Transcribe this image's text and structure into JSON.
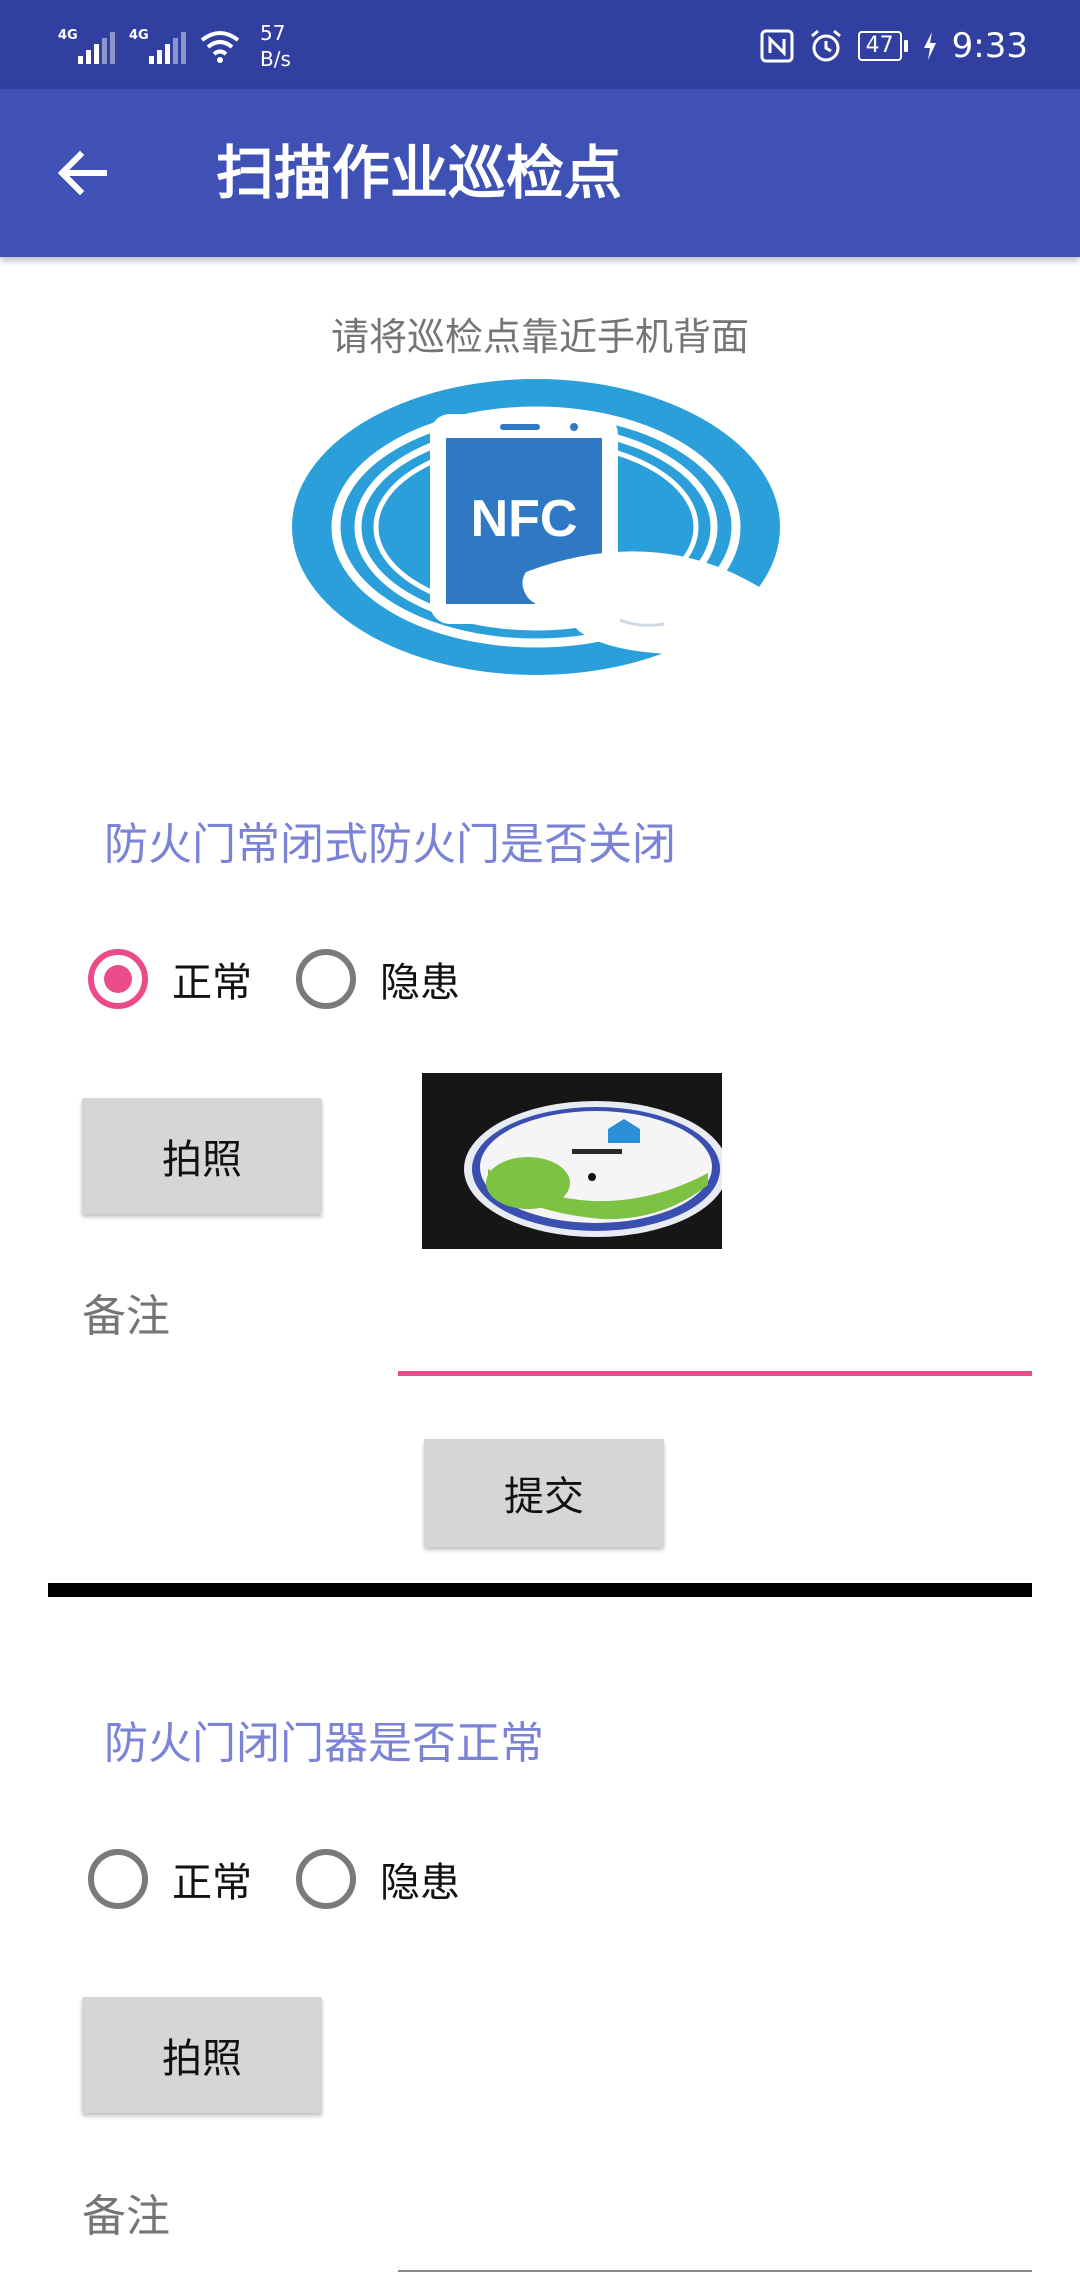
{
  "status_bar": {
    "network_1": "4G",
    "network_2": "4G",
    "speed_value": "57",
    "speed_unit": "B/s",
    "battery": "47",
    "time": "9:33",
    "icons": [
      "signal-icon",
      "wifi-icon",
      "nfc-icon",
      "alarm-icon",
      "battery-icon",
      "charging-icon"
    ]
  },
  "app_bar": {
    "title": "扫描作业巡检点",
    "back_icon": "arrow-back-icon",
    "color": "#3f51b5"
  },
  "hint": "请将巡检点靠近手机背面",
  "nfc_image": {
    "text": "NFC"
  },
  "items": [
    {
      "question": "防火门常闭式防火门是否关闭",
      "options": [
        "正常",
        "隐患"
      ],
      "selected": "正常",
      "photo_button": "拍照",
      "has_photo": true,
      "note_label": "备注",
      "note_value": "",
      "submit_button": "提交"
    },
    {
      "question": "防火门闭门器是否正常",
      "options": [
        "正常",
        "隐患"
      ],
      "selected": null,
      "photo_button": "拍照",
      "has_photo": false,
      "note_label": "备注",
      "note_value": ""
    }
  ],
  "colors": {
    "accent": "#ea4c89",
    "question_text": "#7b83d6",
    "status_bar": "#3140a0"
  }
}
